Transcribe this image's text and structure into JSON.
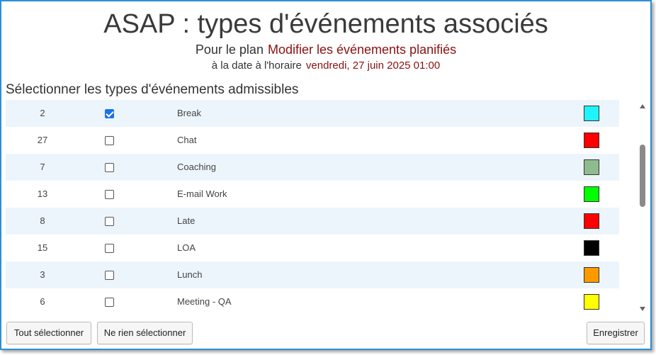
{
  "header": {
    "title": "ASAP : types d'événements associés",
    "plan_label": "Pour le plan",
    "plan_value": "Modifier les événements planifiés",
    "date_label": "à la date à l'horaire",
    "date_value": "vendredi, 27 juin 2025 01:00"
  },
  "list": {
    "section_label": "Sélectionner les types d'événements admissibles",
    "rows": [
      {
        "id": "2",
        "checked": true,
        "name": "Break",
        "color": "#1ef4ff"
      },
      {
        "id": "27",
        "checked": false,
        "name": "Chat",
        "color": "#ff0000"
      },
      {
        "id": "7",
        "checked": false,
        "name": "Coaching",
        "color": "#8fbc8f"
      },
      {
        "id": "13",
        "checked": false,
        "name": "E-mail Work",
        "color": "#00ff00"
      },
      {
        "id": "8",
        "checked": false,
        "name": "Late",
        "color": "#ff0000"
      },
      {
        "id": "15",
        "checked": false,
        "name": "LOA",
        "color": "#000000"
      },
      {
        "id": "3",
        "checked": false,
        "name": "Lunch",
        "color": "#ff9900"
      },
      {
        "id": "6",
        "checked": false,
        "name": "Meeting - QA",
        "color": "#ffff00"
      }
    ]
  },
  "footer": {
    "select_all_label": "Tout sélectionner",
    "select_none_label": "Ne rien sélectionner",
    "save_label": "Enregistrer"
  },
  "colors": {
    "accent_border": "#2a8fd6",
    "highlight_text": "#8b1010",
    "alt_row": "#edf5fc"
  }
}
